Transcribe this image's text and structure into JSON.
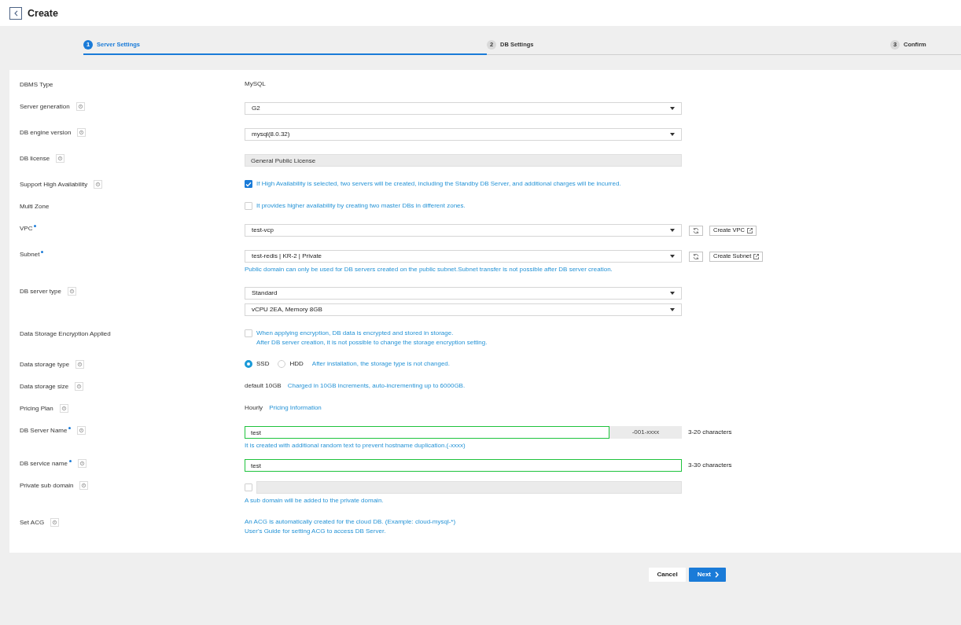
{
  "header": {
    "title": "Create"
  },
  "steps": [
    {
      "number": "1",
      "label": "Server Settings",
      "selected": true
    },
    {
      "number": "2",
      "label": "DB Settings",
      "selected": false
    },
    {
      "number": "3",
      "label": "Confirm",
      "selected": false
    }
  ],
  "fields": [
    {
      "kind": "text",
      "label": "DBMS Type",
      "required": false,
      "help": false,
      "value": "MySQL"
    },
    {
      "kind": "select",
      "label": "Server generation",
      "required": false,
      "help": true,
      "selects": [
        {
          "value": "G2"
        }
      ]
    },
    {
      "kind": "select",
      "label": "DB engine version",
      "required": false,
      "help": true,
      "selects": [
        {
          "value": "mysql(8.0.32)"
        }
      ]
    },
    {
      "kind": "input",
      "label": "DB license",
      "required": false,
      "help": true,
      "value": "General Public License",
      "disabled": true,
      "valid": false
    },
    {
      "kind": "checkbox",
      "label": "Support High Availability",
      "required": false,
      "help": true,
      "checked": true,
      "lines": [
        "If High Availability is selected, two servers will be created, including the Standby DB Server, and additional charges will be incurred."
      ]
    },
    {
      "kind": "checkbox",
      "label": "Multi Zone",
      "required": false,
      "help": false,
      "checked": false,
      "lines": [
        "It provides higher availability by creating two master DBs in different zones."
      ]
    },
    {
      "kind": "select",
      "label": "VPC",
      "required": true,
      "help": false,
      "selects": [
        {
          "value": "test-vcp",
          "actions": [
            {
              "kind": "refresh"
            },
            {
              "kind": "create",
              "label": "Create VPC"
            }
          ]
        }
      ]
    },
    {
      "kind": "select",
      "label": "Subnet",
      "required": true,
      "help": false,
      "selects": [
        {
          "value": "test-redis | KR-2 | Private",
          "actions": [
            {
              "kind": "refresh"
            },
            {
              "kind": "create",
              "label": "Create Subnet"
            }
          ]
        }
      ],
      "hint": "Public domain can only be used for DB servers created on the public subnet.Subnet transfer is not possible after DB server creation."
    },
    {
      "kind": "select",
      "label": "DB server type",
      "required": false,
      "help": true,
      "selects": [
        {
          "value": "Standard"
        },
        {
          "value": "vCPU 2EA, Memory 8GB"
        }
      ]
    },
    {
      "kind": "checkbox",
      "label": "Data Storage Encryption Applied",
      "required": false,
      "help": false,
      "checked": false,
      "lines": [
        "When applying encryption, DB data is encrypted and stored in storage.",
        "After DB server creation, it is not possible to change the storage encryption setting."
      ]
    },
    {
      "kind": "radio",
      "label": "Data storage type",
      "required": false,
      "help": true,
      "options": [
        {
          "label": "SSD",
          "selected": true
        },
        {
          "label": "HDD",
          "selected": false
        }
      ],
      "note": "After installation, the storage type is not changed."
    },
    {
      "kind": "text",
      "label": "Data storage size",
      "required": false,
      "help": true,
      "value": "default 10GB",
      "note": "Charged in 10GB increments, auto-incrementing up to 6000GB."
    },
    {
      "kind": "text",
      "label": "Pricing Plan",
      "required": false,
      "help": true,
      "value": "Hourly",
      "link": "Pricing Information"
    },
    {
      "kind": "input",
      "label": "DB Server Name",
      "required": true,
      "help": true,
      "value": "test",
      "disabled": false,
      "valid": true,
      "suffix": "-001-xxxx",
      "limit": "3-20 characters",
      "hint": "It is created with additional random text to prevent hostname duplication.(-xxxx)"
    },
    {
      "kind": "input",
      "label": "DB service name",
      "required": true,
      "help": true,
      "value": "test",
      "disabled": false,
      "valid": true,
      "limit": "3-30 characters"
    },
    {
      "kind": "input",
      "label": "Private sub domain",
      "required": false,
      "help": true,
      "checked": false,
      "disabled": true,
      "valid": false,
      "hint": "A sub domain will be added to the private domain."
    },
    {
      "kind": "note",
      "label": "Set ACG",
      "required": false,
      "help": true,
      "lines": [
        "An ACG is automatically created for the cloud DB. (Example: cloud-mysql-*)",
        "User's Guide for setting ACG to access DB Server."
      ]
    }
  ],
  "buttons": [
    {
      "kind": "secondary",
      "label": "Cancel"
    },
    {
      "kind": "primary",
      "label": "Next"
    }
  ]
}
